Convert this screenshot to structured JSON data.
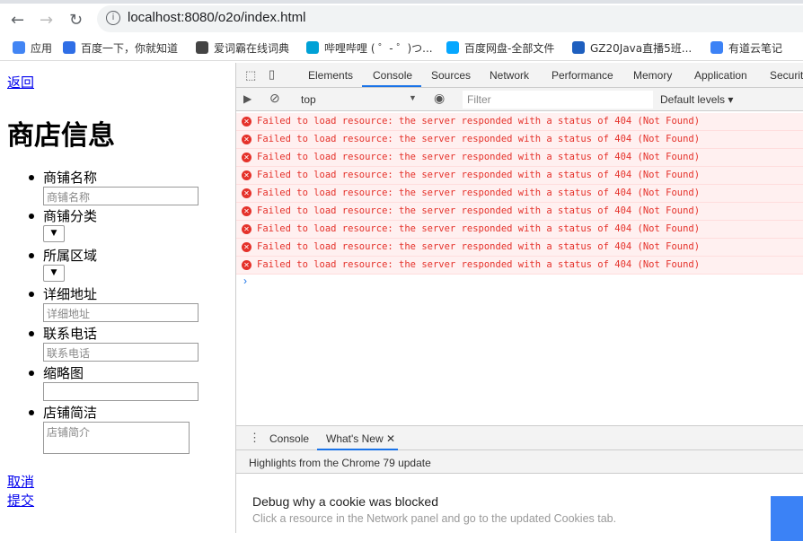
{
  "browser": {
    "url": "localhost:8080/o2o/index.html",
    "bookmarks": [
      {
        "label": "应用",
        "color": "#4285f4"
      },
      {
        "label": "百度一下，你就知道",
        "color": "#2f6ee6"
      },
      {
        "label": "爱词霸在线词典",
        "color": "#444444"
      },
      {
        "label": "哔哩哔哩 ( ゜- ゜)つ...",
        "color": "#00a1d6"
      },
      {
        "label": "百度网盘-全部文件",
        "color": "#06a7ff"
      },
      {
        "label": "GZ20Java直播5班...",
        "color": "#1e5fbf"
      },
      {
        "label": "有道云笔记",
        "color": "#3c82f6"
      }
    ]
  },
  "page": {
    "back": "返回",
    "title": "商店信息",
    "fields": [
      {
        "label": "商铺名称",
        "type": "input",
        "placeholder": "商铺名称"
      },
      {
        "label": "商铺分类",
        "type": "select"
      },
      {
        "label": "所属区域",
        "type": "select"
      },
      {
        "label": "详细地址",
        "type": "input",
        "placeholder": "详细地址"
      },
      {
        "label": "联系电话",
        "type": "input",
        "placeholder": "联系电话"
      },
      {
        "label": "缩略图",
        "type": "input",
        "placeholder": ""
      },
      {
        "label": "店铺简洁",
        "type": "textarea",
        "placeholder": "店铺简介"
      }
    ],
    "cancel": "取消",
    "submit": "提交"
  },
  "devtools": {
    "tabs": [
      "Elements",
      "Console",
      "Sources",
      "Network",
      "Performance",
      "Memory",
      "Application",
      "Security"
    ],
    "active_tab": "Console",
    "context": "top",
    "filter_placeholder": "Filter",
    "levels": "Default levels",
    "error_message": "Failed to load resource: the server responded with a status of 404 (Not Found)",
    "error_count": 9,
    "drawer": {
      "tabs": [
        "Console",
        "What's New"
      ],
      "active": "What's New",
      "highlights": "Highlights from the Chrome 79 update",
      "item_title": "Debug why a cookie was blocked",
      "item_desc": "Click a resource in the Network panel and go to the updated Cookies tab."
    }
  },
  "colors": {
    "accent": "#1a73e8",
    "error": "#e5312a",
    "error_bg": "#fff0f0"
  }
}
